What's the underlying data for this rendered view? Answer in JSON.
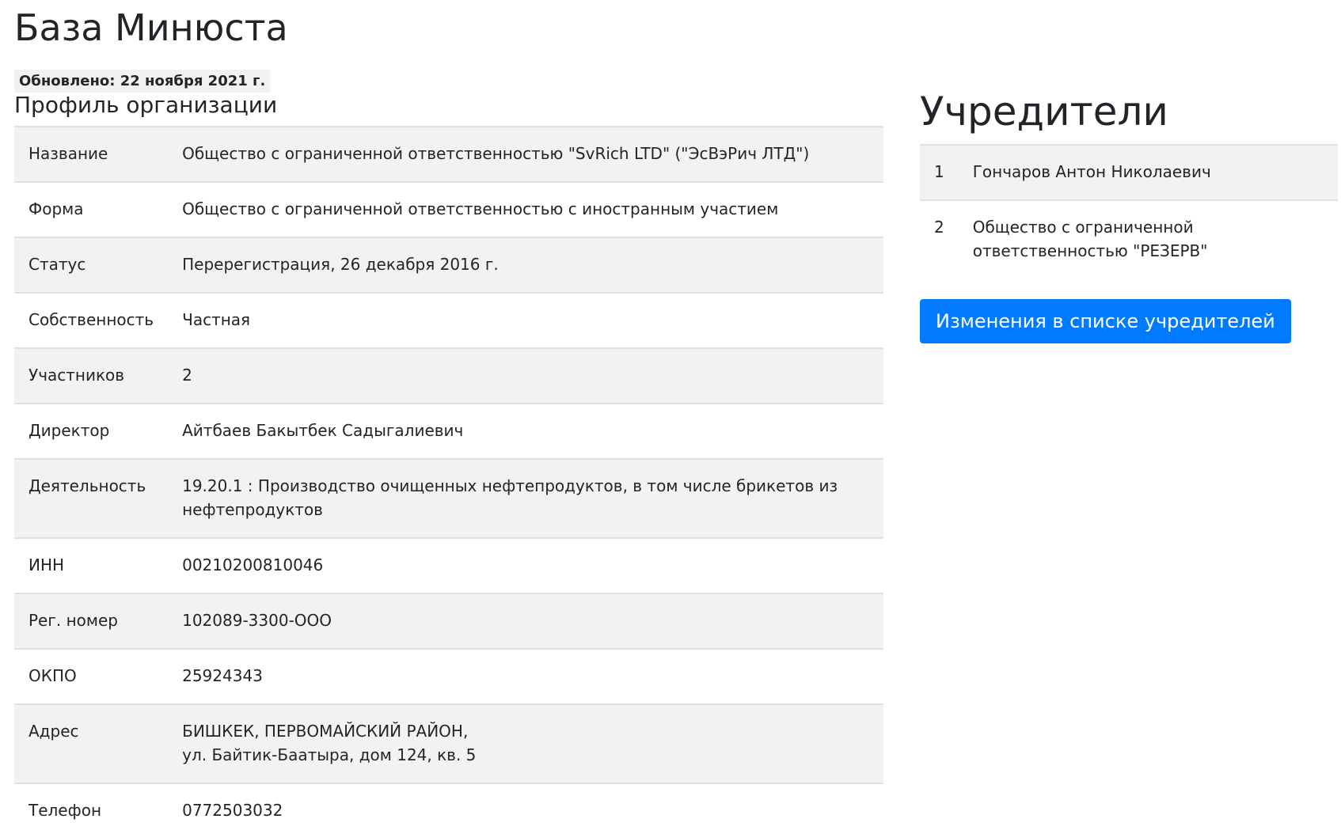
{
  "header": {
    "title": "База Минюста",
    "updated": "Обновлено: 22 ноября 2021 г."
  },
  "profile": {
    "title": "Профиль организации",
    "rows": [
      {
        "key": "Название",
        "value": "Общество с ограниченной ответственностью \"SvRich LTD\" (\"ЭсВэРич ЛТД\")"
      },
      {
        "key": "Форма",
        "value": "Общество с ограниченной ответственностью с иностранным участием"
      },
      {
        "key": "Статус",
        "value": "Перерегистрация, 26 декабря 2016 г."
      },
      {
        "key": "Собственность",
        "value": "Частная"
      },
      {
        "key": "Участников",
        "value": "2"
      },
      {
        "key": "Директор",
        "value": "Айтбаев Бакытбек Садыгалиевич"
      },
      {
        "key": "Деятельность",
        "value": "19.20.1 : Производство очищенных нефтепродуктов, в том числе брикетов из нефтепродуктов"
      },
      {
        "key": "ИНН",
        "value": "00210200810046"
      },
      {
        "key": "Рег. номер",
        "value": "102089-3300-ООО"
      },
      {
        "key": "ОКПО",
        "value": "25924343"
      },
      {
        "key": "Адрес",
        "value_line1": "БИШКЕК, ПЕРВОМАЙСКИЙ РАЙОН,",
        "value_line2": "ул. Байтик-Баатыра, дом 124, кв. 5"
      },
      {
        "key": "Телефон",
        "value": "0772503032"
      }
    ]
  },
  "founders": {
    "title": "Учредители",
    "rows": [
      {
        "num": "1",
        "name": "Гончаров Антон Николаевич"
      },
      {
        "num": "2",
        "name": "Общество с ограниченной ответственностью \"РЕЗЕРВ\""
      }
    ],
    "changes_button": "Изменения в списке учредителей"
  },
  "colors": {
    "accent": "#007bff",
    "stripe": "#f2f2f2",
    "border": "#dee2e6",
    "text": "#212529"
  }
}
